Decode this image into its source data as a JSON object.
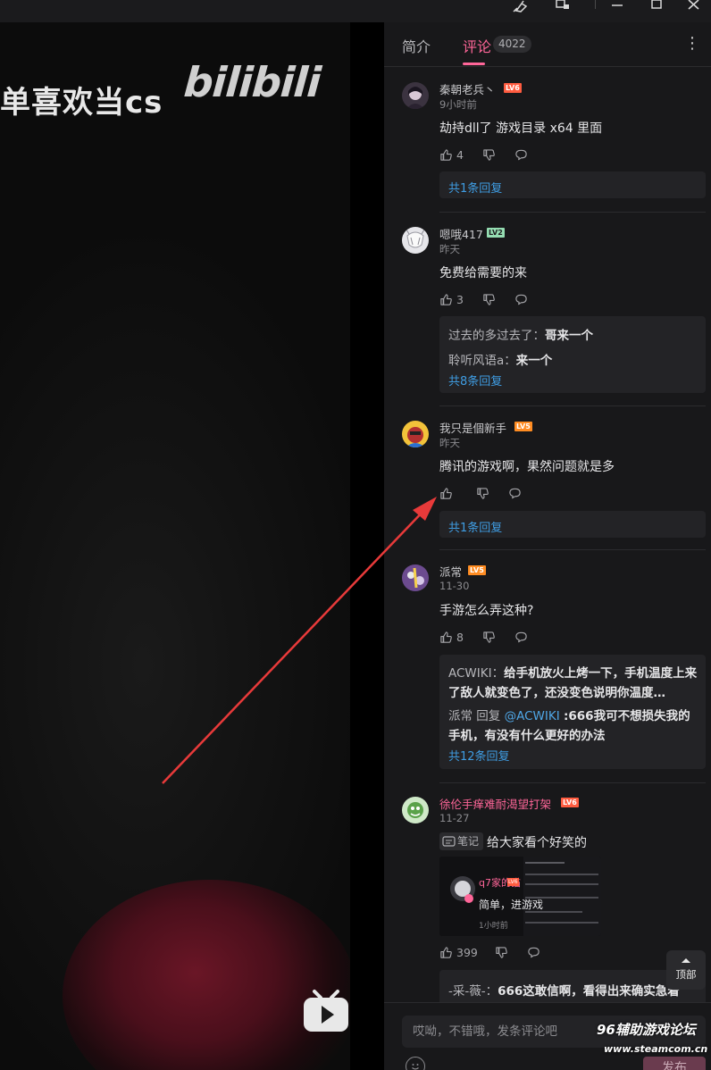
{
  "video": {
    "overlay_text": "单喜欢当cs",
    "logo_text": "bilibili"
  },
  "tabs": [
    {
      "label": "简介",
      "active": false
    },
    {
      "label": "评论",
      "active": true,
      "count": "4022"
    }
  ],
  "comments": [
    {
      "user": "秦朝老兵丶",
      "level": "LV6",
      "time": "9小时前",
      "text": "劫持dll了 游戏目录 x64 里面",
      "likes": "4",
      "replies": [],
      "more_replies": "共1条回复",
      "name_color": "default"
    },
    {
      "user": "嗯哦417",
      "level": "LV2",
      "time": "昨天",
      "text": "免费给需要的来",
      "likes": "3",
      "replies": [
        {
          "user": "过去的多过去了",
          "text": "哥来一个"
        },
        {
          "user": "聆听风语a",
          "text": "来一个"
        }
      ],
      "more_replies": "共8条回复",
      "name_color": "default"
    },
    {
      "user": "我只是個新手",
      "level": "LV5",
      "time": "昨天",
      "text": "腾讯的游戏啊，果然问题就是多",
      "likes": "",
      "replies": [],
      "more_replies": "共1条回复",
      "name_color": "default"
    },
    {
      "user": "派常",
      "level": "LV5",
      "time": "11-30",
      "text": "手游怎么弄这种?",
      "likes": "8",
      "replies": [
        {
          "user": "ACWIKI",
          "text": "给手机放火上烤一下，手机温度上来了敌人就变色了，还没变色说明你温度…"
        },
        {
          "user": "派常",
          "reply_word": "回复",
          "at": "@ACWIKI",
          "text": ":666我可不想损失我的手机，有没有什么更好的办法"
        }
      ],
      "more_replies": "共12条回复",
      "name_color": "default"
    },
    {
      "user": "徐伦手痒难耐渴望打架",
      "level": "LV6",
      "time": "11-27",
      "note_badge": "笔记",
      "text": "给大家看个好笑的",
      "likes": "399",
      "replies": [
        {
          "user": "-采-薇-",
          "text": "666这敢信啊，看得出来确实急着"
        }
      ],
      "name_color": "pink",
      "thumb": {
        "user": "q7家的猫",
        "level": "LV6",
        "text": "简单，进游戏",
        "time": "1小时前"
      }
    }
  ],
  "back_to_top": "顶部",
  "input": {
    "placeholder": "哎呦，不错哦，发条评论吧"
  },
  "send_label": "发布",
  "emoji_label": "表情",
  "watermark": {
    "line1": "96辅助游戏论坛",
    "line2": "www.steamcom.cn"
  },
  "colors": {
    "accent": "#ff6699",
    "link": "#3f9de3",
    "panel_bg": "#18181a",
    "reply_bg": "#232326"
  }
}
